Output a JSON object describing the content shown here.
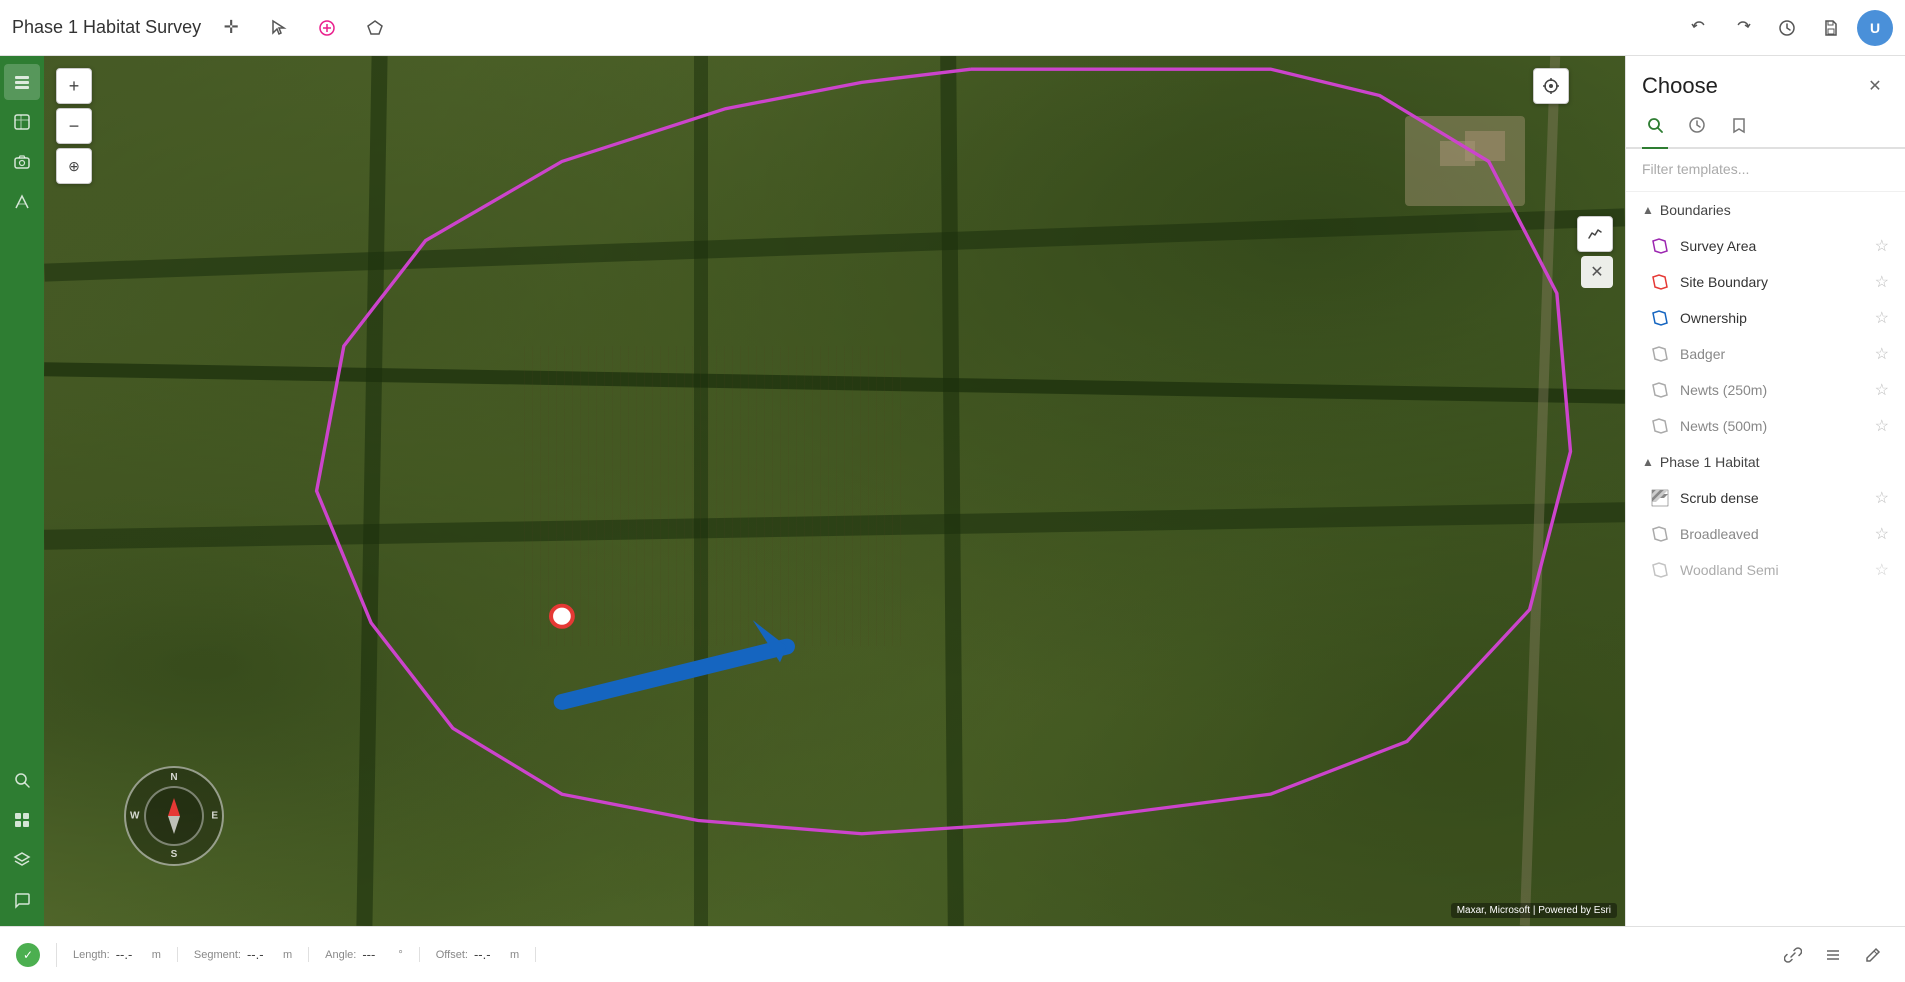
{
  "app": {
    "title": "Phase 1 Habitat Survey"
  },
  "topbar": {
    "icons": [
      {
        "name": "move-tool",
        "symbol": "✛"
      },
      {
        "name": "select-tool",
        "symbol": "⬚"
      },
      {
        "name": "add-tool",
        "symbol": "⊕"
      },
      {
        "name": "polygon-tool",
        "symbol": "⬠"
      }
    ],
    "right_icons": [
      {
        "name": "undo",
        "symbol": "↩"
      },
      {
        "name": "redo",
        "symbol": "↪"
      },
      {
        "name": "history",
        "symbol": "⟳"
      },
      {
        "name": "save",
        "symbol": "🔖"
      }
    ],
    "avatar_initials": "U"
  },
  "sidebar": {
    "items": [
      {
        "name": "layers",
        "symbol": "⊞"
      },
      {
        "name": "map-view",
        "symbol": "🗺"
      },
      {
        "name": "camera",
        "symbol": "📷"
      },
      {
        "name": "route",
        "symbol": "↗"
      },
      {
        "name": "search",
        "symbol": "🔍"
      },
      {
        "name": "grid",
        "symbol": "⊞"
      },
      {
        "name": "stack",
        "symbol": "≡"
      },
      {
        "name": "comment",
        "symbol": "💬"
      }
    ]
  },
  "map": {
    "attribution": "Maxar, Microsoft | Powered by Esri",
    "locate_btn": "◎",
    "zoom_in": "+",
    "zoom_out": "−",
    "crosshair": "⊕",
    "close_btn": "✕"
  },
  "compass": {
    "n": "N",
    "s": "S",
    "e": "E",
    "w": "W"
  },
  "panel": {
    "title": "Choose",
    "close": "✕",
    "tabs": [
      {
        "name": "search",
        "symbol": "🔍",
        "active": true
      },
      {
        "name": "recent",
        "symbol": "🕐",
        "active": false
      },
      {
        "name": "bookmark",
        "symbol": "🔖",
        "active": false
      }
    ],
    "filter_placeholder": "Filter templates...",
    "sections": [
      {
        "name": "Boundaries",
        "label": "Boundaries",
        "expanded": true,
        "items": [
          {
            "label": "Survey Area",
            "icon_type": "polygon-purple",
            "muted": false
          },
          {
            "label": "Site Boundary",
            "icon_type": "polygon-red",
            "muted": false
          },
          {
            "label": "Ownership",
            "icon_type": "polygon-blue",
            "muted": false
          },
          {
            "label": "Badger",
            "icon_type": "polygon-gray",
            "muted": true
          },
          {
            "label": "Newts (250m)",
            "icon_type": "polygon-gray",
            "muted": true
          },
          {
            "label": "Newts (500m)",
            "icon_type": "polygon-gray",
            "muted": true
          }
        ]
      },
      {
        "name": "Phase1Habitat",
        "label": "Phase 1 Habitat",
        "expanded": true,
        "items": [
          {
            "label": "Scrub dense",
            "icon_type": "pattern-green",
            "muted": false
          },
          {
            "label": "Broadleaved",
            "icon_type": "polygon-gray",
            "muted": true
          },
          {
            "label": "Woodland Semi",
            "icon_type": "polygon-gray",
            "muted": true
          }
        ]
      }
    ]
  },
  "bottombar": {
    "dot_color": "#4caf50",
    "groups": [
      {
        "label": "Length:",
        "value": "--.-",
        "unit": "m"
      },
      {
        "label": "Segment:",
        "value": "--.-",
        "unit": "m"
      },
      {
        "label": "Angle:",
        "value": "---",
        "unit": "°"
      },
      {
        "label": "Offset:",
        "value": "--.-",
        "unit": "m"
      }
    ],
    "right_icons": [
      {
        "name": "link",
        "symbol": "🔗"
      },
      {
        "name": "list",
        "symbol": "☰"
      },
      {
        "name": "edit",
        "symbol": "✏"
      }
    ]
  }
}
